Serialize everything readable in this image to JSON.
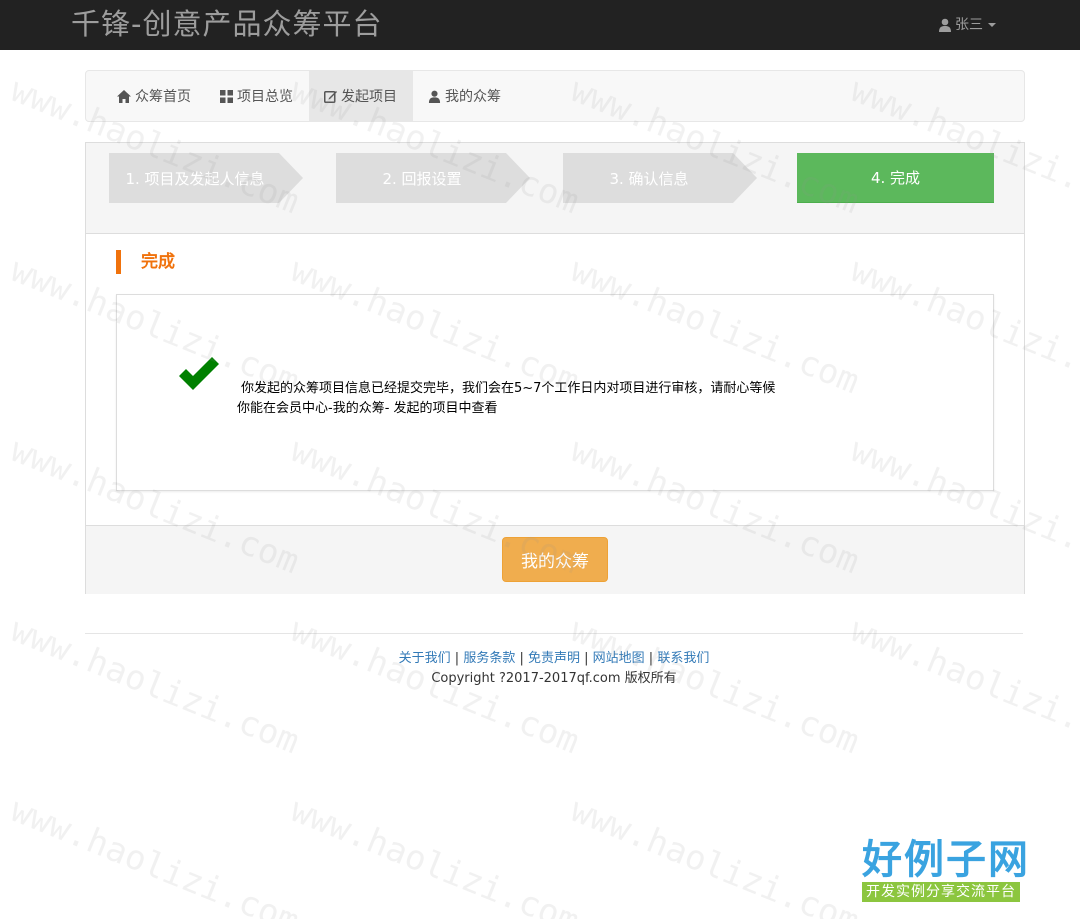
{
  "navbar": {
    "brand": "千锋-创意产品众筹平台",
    "user": "张三"
  },
  "subnav": {
    "tabs": [
      {
        "label": "众筹首页",
        "icon": "home-icon"
      },
      {
        "label": "项目总览",
        "icon": "grid-icon"
      },
      {
        "label": "发起项目",
        "icon": "edit-icon",
        "active": true
      },
      {
        "label": "我的众筹",
        "icon": "user-icon"
      }
    ]
  },
  "steps": [
    {
      "label": "1. 项目及发起人信息"
    },
    {
      "label": "2. 回报设置"
    },
    {
      "label": "3. 确认信息"
    },
    {
      "label": "4. 完成",
      "active": true
    }
  ],
  "section": {
    "title": "完成",
    "message_line1": "你发起的众筹项目信息已经提交完毕，我们会在5~7个工作日内对项目进行审核，请耐心等候",
    "message_line2": "你能在会员中心-我的众筹- 发起的项目中查看"
  },
  "actions": {
    "my_crowdfunding_button": "我的众筹"
  },
  "footer": {
    "links": [
      "关于我们",
      "服务条款",
      "免责声明",
      "网站地图",
      "联系我们"
    ],
    "separator": " | ",
    "copyright": "Copyright ?2017-2017qf.com 版权所有"
  },
  "watermark": {
    "text": "www.haolizi.com",
    "logo_title": "好例子网",
    "logo_subtitle": "开发实例分享交流平台"
  },
  "colors": {
    "navbar_bg": "#222222",
    "accent_orange": "#f0720c",
    "step_done_green": "#5cb85c",
    "button_warning": "#f0ad4e",
    "link_blue": "#337ab7",
    "check_green": "#008000"
  }
}
